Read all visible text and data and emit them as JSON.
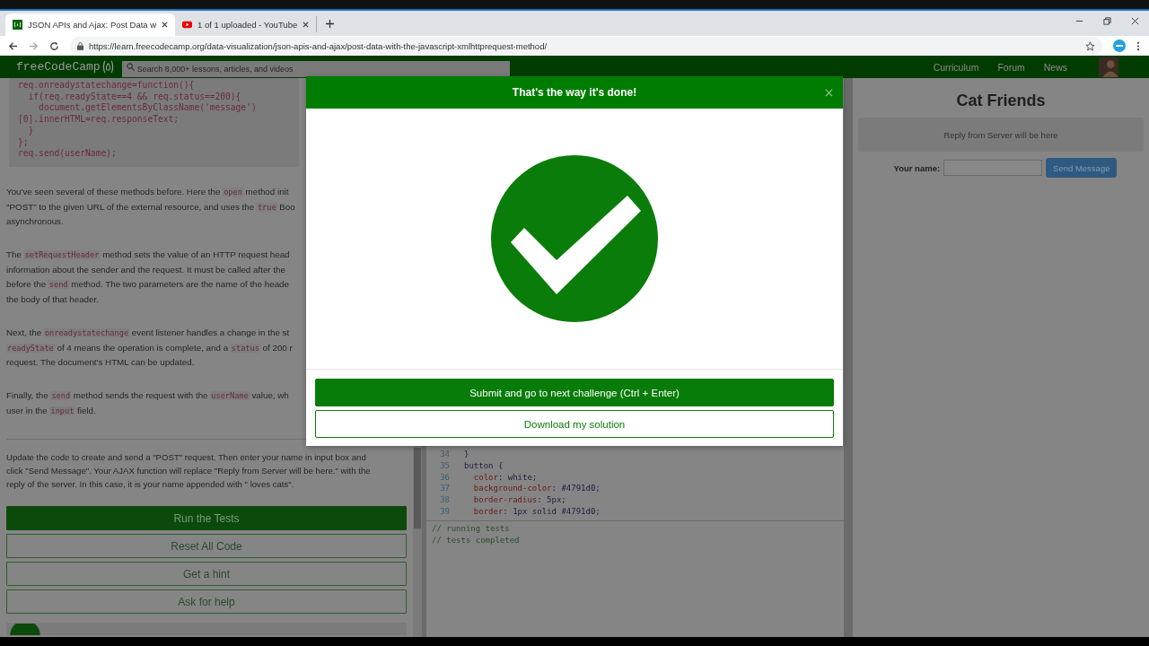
{
  "browser": {
    "tabs": [
      {
        "title": "JSON APIs and Ajax: Post Data w",
        "kind": "freecodecamp",
        "selected": true
      },
      {
        "title": "1 of 1 uploaded - YouTube",
        "kind": "youtube",
        "selected": false
      }
    ],
    "address": "https://learn.freecodecamp.org/data-visualization/json-apis-and-ajax/post-data-with-the-javascript-xmlhttprequest-method/"
  },
  "nav": {
    "logo": "freeCodeCamp",
    "search_placeholder": "Search 8,000+ lessons, articles, and videos",
    "links": [
      "Curriculum",
      "Forum",
      "News"
    ]
  },
  "lesson": {
    "code": [
      "req.onreadystatechange=function(){",
      "  if(req.readyState==4 && req.status==200){",
      "    document.getElementsByClassName('message')",
      "[0].innerHTML=req.responseText;",
      "  }",
      "};",
      "req.send(userName);"
    ],
    "paragraphs": [
      [
        [
          {
            "text": "You've seen several of these methods before. Here the "
          },
          {
            "text": "open",
            "code": true
          },
          {
            "text": " method init"
          }
        ],
        [
          {
            "text": "\"POST\" to the given URL of the external resource, and uses the "
          },
          {
            "text": "true",
            "code": true
          },
          {
            "text": " Boo"
          }
        ],
        [
          {
            "text": "asynchronous."
          }
        ]
      ],
      [
        [
          {
            "text": "The "
          },
          {
            "text": "setRequestHeader",
            "code": true
          },
          {
            "text": " method sets the value of an HTTP request head"
          }
        ],
        [
          {
            "text": "information about the sender and the request. It must be called after the"
          }
        ],
        [
          {
            "text": "before the "
          },
          {
            "text": "send",
            "code": true
          },
          {
            "text": " method. The two parameters are the name of the heade"
          }
        ],
        [
          {
            "text": "the body of that header."
          }
        ]
      ],
      [
        [
          {
            "text": "Next, the "
          },
          {
            "text": "onreadystatechange",
            "code": true
          },
          {
            "text": " event listener handles a change in the st"
          }
        ],
        [
          {
            "text": "readyState",
            "code": true
          },
          {
            "text": " of 4 means the operation is complete, and a "
          },
          {
            "text": "status",
            "code": true
          },
          {
            "text": " of 200 r"
          }
        ],
        [
          {
            "text": "request. The document's HTML can be updated."
          }
        ]
      ],
      [
        [
          {
            "text": "Finally, the "
          },
          {
            "text": "send",
            "code": true
          },
          {
            "text": " method sends the request with the "
          },
          {
            "text": "userName",
            "code": true
          },
          {
            "text": " value, wh"
          }
        ],
        [
          {
            "text": "user in the "
          },
          {
            "text": "input",
            "code": true
          },
          {
            "text": " field."
          }
        ]
      ]
    ],
    "instructions": [
      "Update the code to create and send a \"POST\" request. Then enter your name in input box and",
      "click \"Send Message\". Your AJAX function will replace \"Reply from Server will be here.\" with the",
      "reply of the server. In this case, it is your name appended with \" loves cats\"."
    ],
    "buttons": [
      {
        "label": "Run the Tests",
        "kind": "primary"
      },
      {
        "label": "Reset All Code",
        "kind": "outline"
      },
      {
        "label": "Get a hint",
        "kind": "outline"
      },
      {
        "label": "Ask for help",
        "kind": "outline"
      }
    ]
  },
  "editor": {
    "lines": [
      {
        "number": "34",
        "segments": [
          {
            "text": "}",
            "kind": "plain"
          }
        ]
      },
      {
        "number": "35",
        "segments": [
          {
            "text": "button {",
            "kind": "plain"
          }
        ]
      },
      {
        "number": "36",
        "segments": [
          {
            "text": "  color",
            "kind": "property"
          },
          {
            "text": ": white;",
            "kind": "plain"
          }
        ]
      },
      {
        "number": "37",
        "segments": [
          {
            "text": "  background-color",
            "kind": "property"
          },
          {
            "text": ": #4791d0;",
            "kind": "plain"
          }
        ]
      },
      {
        "number": "38",
        "segments": [
          {
            "text": "  border-radius",
            "kind": "property"
          },
          {
            "text": ": 5px;",
            "kind": "plain"
          }
        ]
      },
      {
        "number": "39",
        "segments": [
          {
            "text": "  border",
            "kind": "property"
          },
          {
            "text": ": 1px solid #4791d0;",
            "kind": "plain"
          }
        ]
      }
    ],
    "console": [
      "// running tests",
      "// tests completed"
    ]
  },
  "preview": {
    "title": "Cat Friends",
    "message": "Reply from Server will be here",
    "label": "Your name:",
    "button": "Send Message"
  },
  "modal": {
    "title": "That's the way it's done!",
    "buttons": [
      {
        "label": "Submit and go to next challenge (Ctrl + Enter)",
        "kind": "primary"
      },
      {
        "label": "Download my solution",
        "kind": "outline"
      }
    ]
  }
}
